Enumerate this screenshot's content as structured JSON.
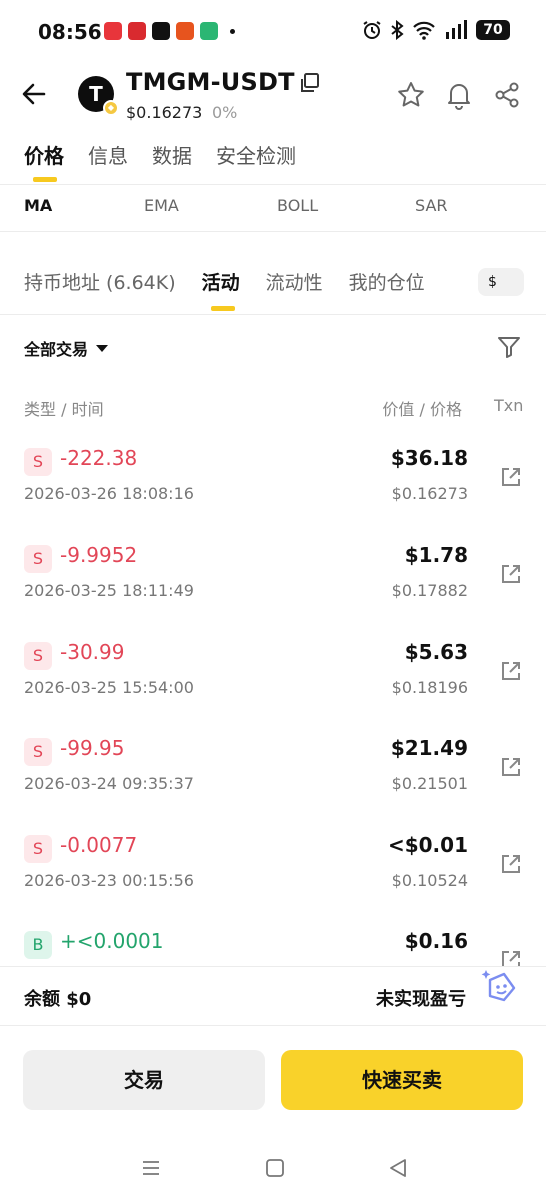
{
  "status_bar": {
    "time": "08:56",
    "battery": "70",
    "app_icon_colors": [
      "#e8353b",
      "#d92a2f",
      "#111111",
      "#e7541e",
      "#2bb673"
    ]
  },
  "header": {
    "avatar_letter": "T",
    "pair": "TMGM-USDT",
    "price": "$0.16273",
    "change": "0%"
  },
  "main_tabs": [
    {
      "label": "价格",
      "active": true
    },
    {
      "label": "信息",
      "active": false
    },
    {
      "label": "数据",
      "active": false
    },
    {
      "label": "安全检测",
      "active": false
    }
  ],
  "indicator_tabs": [
    {
      "label": "MA",
      "active": true
    },
    {
      "label": "EMA",
      "active": false
    },
    {
      "label": "BOLL",
      "active": false
    },
    {
      "label": "SAR",
      "active": false
    }
  ],
  "sub_tabs": [
    {
      "label": "持币地址 (6.64K)",
      "active": false
    },
    {
      "label": "活动",
      "active": true
    },
    {
      "label": "流动性",
      "active": false
    },
    {
      "label": "我的仓位",
      "active": false
    }
  ],
  "currency_toggle": "$",
  "filter": {
    "label": "全部交易"
  },
  "columns": {
    "type_time": "类型 / 时间",
    "value_price": "价值 / 价格",
    "txn": "Txn"
  },
  "trades": [
    {
      "side": "S",
      "type": "sell",
      "amount": "-222.38",
      "time": "2026-03-26 18:08:16",
      "value": "$36.18",
      "price": "$0.16273"
    },
    {
      "side": "S",
      "type": "sell",
      "amount": "-9.9952",
      "time": "2026-03-25 18:11:49",
      "value": "$1.78",
      "price": "$0.17882"
    },
    {
      "side": "S",
      "type": "sell",
      "amount": "-30.99",
      "time": "2026-03-25 15:54:00",
      "value": "$5.63",
      "price": "$0.18196"
    },
    {
      "side": "S",
      "type": "sell",
      "amount": "-99.95",
      "time": "2026-03-24 09:35:37",
      "value": "$21.49",
      "price": "$0.21501"
    },
    {
      "side": "S",
      "type": "sell",
      "amount": "-0.0077",
      "time": "2026-03-23 00:15:56",
      "value": "<$0.01",
      "price": "$0.10524"
    },
    {
      "side": "B",
      "type": "buy",
      "amount": "+<0.0001",
      "time": "",
      "value": "$0.16",
      "price": ""
    }
  ],
  "balance_bar": {
    "balance": "余额 $0",
    "unrealized_pnl": "未实现盈亏"
  },
  "actions": {
    "trade": "交易",
    "quick_trade": "快速买卖"
  },
  "colors": {
    "accent": "#f9d22a",
    "sell": "#e24657",
    "buy": "#23a46c"
  }
}
